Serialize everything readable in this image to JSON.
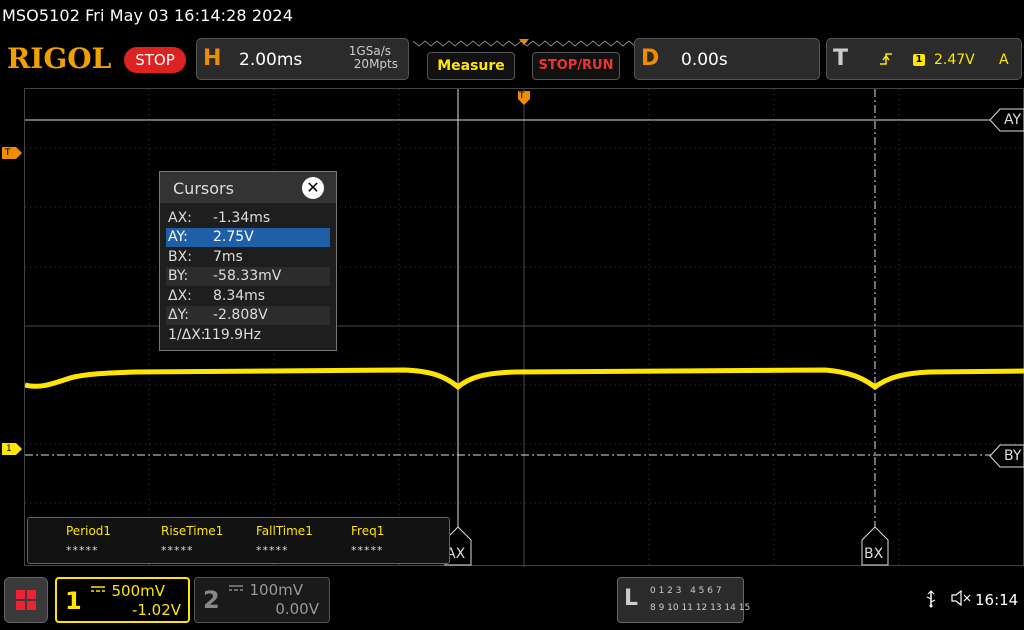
{
  "titlebar": {
    "text": "MSO5102  Fri May 03 16:14:28 2024"
  },
  "brand": {
    "logo": "RIGOL",
    "status": "STOP"
  },
  "horizontal": {
    "letter": "H",
    "timebase": "2.00ms",
    "sample_rate": "1GSa/s",
    "memory_depth": "20Mpts"
  },
  "buttons": {
    "measure": "Measure",
    "stop_run": "STOP/RUN"
  },
  "delay": {
    "letter": "D",
    "value": "0.00s"
  },
  "trigger": {
    "letter": "T",
    "source_badge": "1",
    "level": "2.47V",
    "mode": "A",
    "slope_icon": "rising-edge-icon"
  },
  "screen": {
    "trigger_marker": "T",
    "channel1_marker": "1",
    "cursor_labels": {
      "ay": "AY",
      "by": "BY",
      "ax": "AX",
      "bx": "BX"
    }
  },
  "cursors_dialog": {
    "title": "Cursors",
    "close_icon": "close-icon",
    "rows": [
      {
        "key": "AX:",
        "value": "-1.34ms"
      },
      {
        "key": "AY:",
        "value": "2.75V"
      },
      {
        "key": "BX:",
        "value": "7ms"
      },
      {
        "key": "BY:",
        "value": "-58.33mV"
      },
      {
        "key": "ΔX:",
        "value": "8.34ms"
      },
      {
        "key": "ΔY:",
        "value": "-2.808V"
      },
      {
        "key": "1/ΔX:",
        "value": "119.9Hz"
      }
    ],
    "selected_row": 1
  },
  "measurements": [
    {
      "label": "Period1",
      "value": "*****"
    },
    {
      "label": "RiseTime1",
      "value": "*****"
    },
    {
      "label": "FallTime1",
      "value": "*****"
    },
    {
      "label": "Freq1",
      "value": "*****"
    }
  ],
  "channels": [
    {
      "num": "1",
      "scale": "500mV",
      "offset": "-1.02V",
      "color": "#ffe600",
      "active": true
    },
    {
      "num": "2",
      "scale": "100mV",
      "offset": "0.00V",
      "color": "#777777",
      "active": false
    }
  ],
  "logic": {
    "letter": "L",
    "row1": "0 1 2 3   4 5 6 7",
    "row2": "8 9 10 11 12 13 14 15"
  },
  "status": {
    "usb_icon": "usb-icon",
    "speaker_icon": "speaker-muted-icon",
    "time": "16:14"
  },
  "colors": {
    "accent": "#f08c00",
    "ch1": "#ffe600",
    "stop": "#dd2222",
    "selection": "#1f5fa8"
  }
}
